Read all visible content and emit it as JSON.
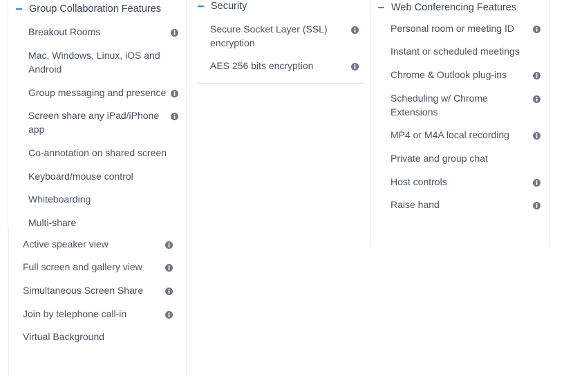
{
  "columns": [
    {
      "header": "Group Collaboration Features",
      "items": [
        {
          "label": "Breakout Rooms",
          "info": true
        },
        {
          "label": "Mac, Windows, Linux, iOS and Android",
          "info": false
        },
        {
          "label": "Group messaging and presence",
          "info": true
        },
        {
          "label": "Screen share any iPad/iPhone app",
          "info": true
        },
        {
          "label": "Co-annotation on shared screen",
          "info": false
        },
        {
          "label": "Keyboard/mouse control",
          "info": false
        },
        {
          "label": "Whiteboarding",
          "info": false
        },
        {
          "label": "Multi-share",
          "info": false
        }
      ],
      "extra_items": [
        {
          "label": "Active speaker view",
          "info": true
        },
        {
          "label": "Full screen and gallery view",
          "info": true
        },
        {
          "label": "Simultaneous Screen Share",
          "info": true
        },
        {
          "label": "Join by telephone call-in",
          "info": true
        },
        {
          "label": "Virtual Background",
          "info": false
        }
      ]
    },
    {
      "header": "Security",
      "items": [
        {
          "label": "Secure Socket Layer (SSL) encryption",
          "info": true
        },
        {
          "label": "AES 256 bits encryption",
          "info": true
        }
      ]
    },
    {
      "header": "Web Conferencing Features",
      "items": [
        {
          "label": "Personal room or meeting ID",
          "info": true
        },
        {
          "label": "Instant or scheduled meetings",
          "info": false
        },
        {
          "label": "Chrome & Outlook plug-ins",
          "info": true
        },
        {
          "label": "Scheduling w/ Chrome Extensions",
          "info": true
        },
        {
          "label": "MP4 or M4A local recording",
          "info": true
        },
        {
          "label": "Private and group chat",
          "info": false
        },
        {
          "label": "Host controls",
          "info": true
        },
        {
          "label": "Raise hand",
          "info": true
        }
      ]
    }
  ],
  "colors": {
    "accent": "#2d8cff",
    "text": "#4a5260",
    "icon": "#747487",
    "divider": "#e4e7eb"
  },
  "icons": {
    "info": "info-icon",
    "collapse": "collapse-minus-icon"
  }
}
